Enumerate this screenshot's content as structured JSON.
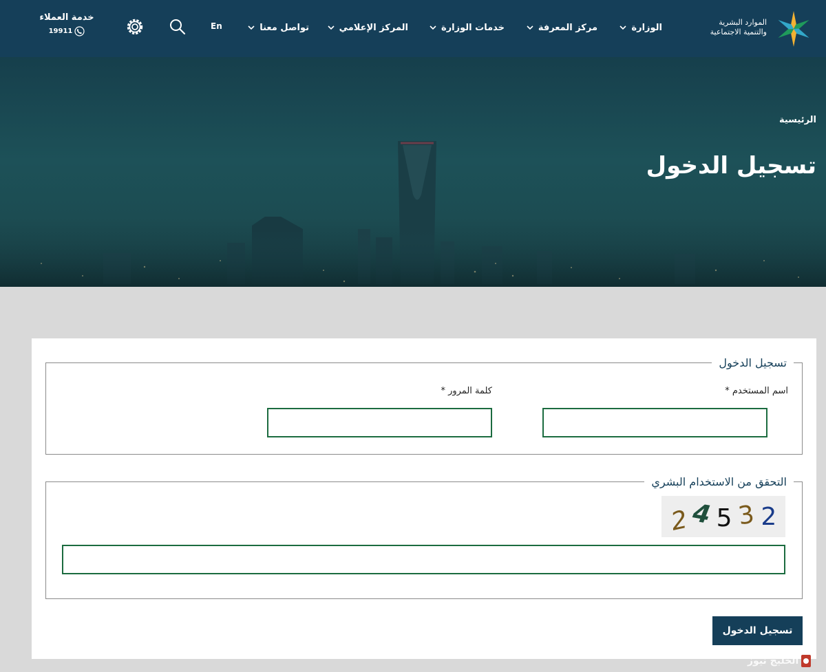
{
  "header": {
    "logo_text_line1": "الموارد البشرية",
    "logo_text_line2": "والتنمية الاجتماعية",
    "nav": [
      {
        "label": "الوزارة"
      },
      {
        "label": "مركز المعرفة"
      },
      {
        "label": "خدمات الوزارة"
      },
      {
        "label": "المركز الإعلامي"
      },
      {
        "label": "تواصل معنا"
      }
    ],
    "language_label": "En",
    "customer_service_label": "خدمة العملاء",
    "customer_service_number": "19911"
  },
  "hero": {
    "breadcrumb": "الرئيسية",
    "title": "تسجيل الدخول"
  },
  "login_form": {
    "legend": "تسجيل الدخول",
    "username_label": "اسم المستخدم *",
    "username_value": "",
    "password_label": "كلمة المرور *",
    "password_value": ""
  },
  "captcha": {
    "legend": "التحقق من الاستخدام البشري",
    "digits": [
      "2",
      "4",
      "5",
      "3",
      "2"
    ],
    "input_value": ""
  },
  "submit_label": "تسجيل الدخول",
  "watermark_text": "الخليج نيوز",
  "colors": {
    "header_bg": "#153f59",
    "accent_green": "#1b6b3f",
    "button_bg": "#153f59",
    "page_bg": "#d9d9d9"
  }
}
